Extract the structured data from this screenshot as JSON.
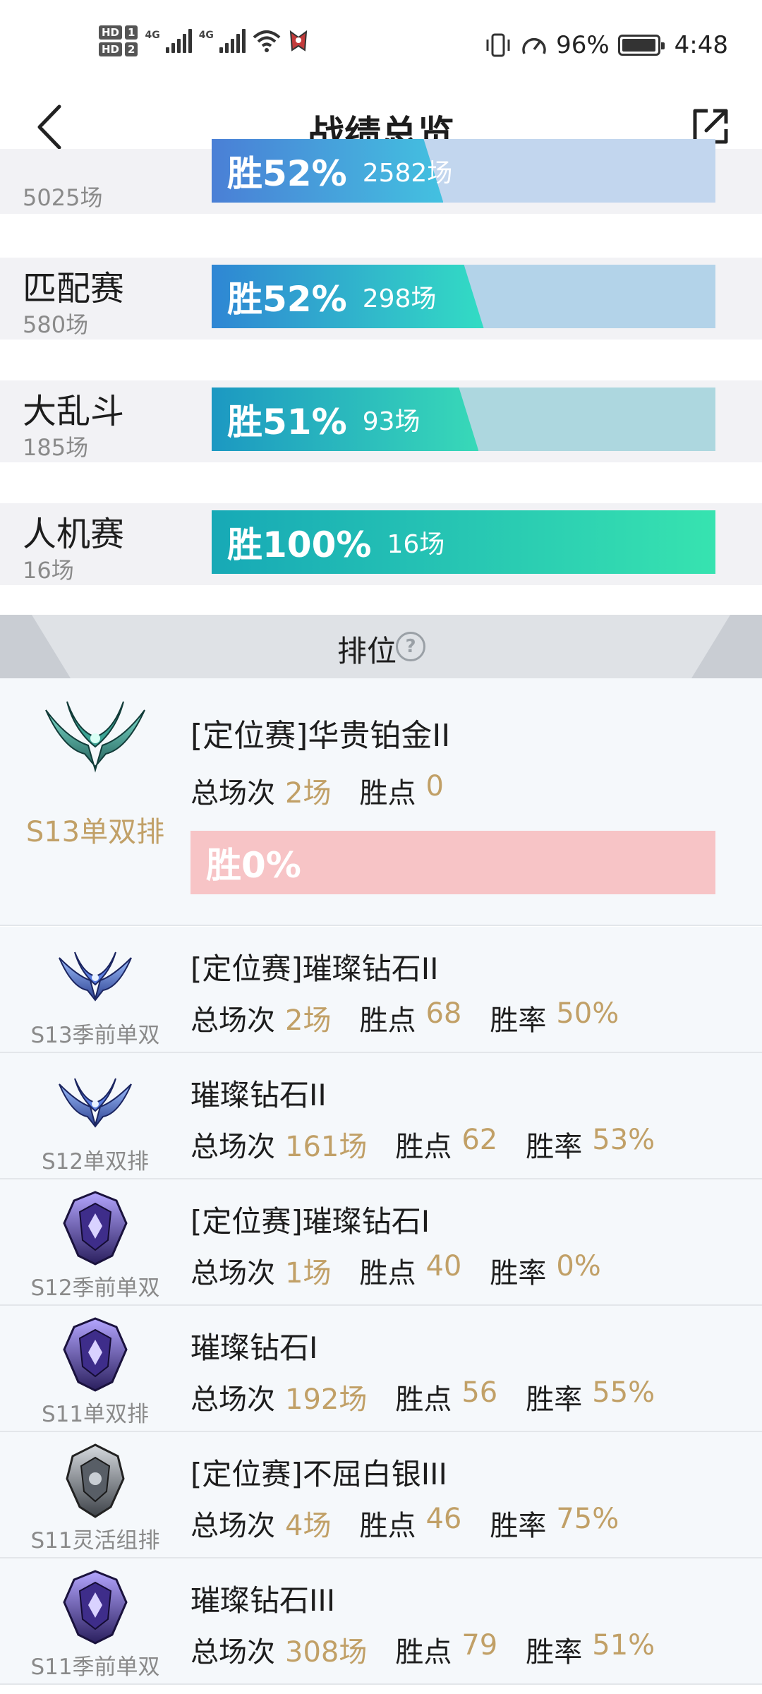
{
  "status_bar": {
    "left": {
      "hd1": "HD",
      "sim1": "1",
      "hd2": "HD",
      "sim2": "2",
      "net1": "4G",
      "net2": "4G"
    },
    "battery_percent": "96%",
    "time": "4:48"
  },
  "header": {
    "title": "战绩总览"
  },
  "modes": [
    {
      "name": "",
      "count": "5025场",
      "rate": "胜52%",
      "games": "2582场",
      "fill": 0.46,
      "colors": [
        "#4a7fd6",
        "#43c1e0"
      ],
      "track": "#c2d6ee"
    },
    {
      "name": "匹配赛",
      "count": "580场",
      "rate": "胜52%",
      "games": "298场",
      "fill": 0.54,
      "colors": [
        "#2f86d4",
        "#32dcc4"
      ],
      "track": "#b3d3e9"
    },
    {
      "name": "大乱斗",
      "count": "185场",
      "rate": "胜51%",
      "games": "93场",
      "fill": 0.53,
      "colors": [
        "#1c98c2",
        "#38d9b8"
      ],
      "track": "#add7df"
    },
    {
      "name": "人机赛",
      "count": "16场",
      "rate": "胜100%",
      "games": "16场",
      "fill": 1.0,
      "colors": [
        "#17a9b6",
        "#37e3b0"
      ],
      "track": "#b1e0de"
    }
  ],
  "ranked": {
    "title": "排位",
    "help": "?",
    "labels": {
      "total": "总场次",
      "points": "胜点",
      "winrate": "胜率"
    },
    "first": {
      "season": "S13单双排",
      "rank": "[定位赛]华贵铂金II",
      "total": "2场",
      "points": "0",
      "rate": "胜0%",
      "emblem": "platinum"
    },
    "rows": [
      {
        "season": "S13季前单双",
        "rank": "[定位赛]璀璨钻石II",
        "total": "2场",
        "points": "68",
        "winrate": "50%",
        "emblem": "diamond-wings"
      },
      {
        "season": "S12单双排",
        "rank": "璀璨钻石II",
        "total": "161场",
        "points": "62",
        "winrate": "53%",
        "emblem": "diamond-wings"
      },
      {
        "season": "S12季前单双",
        "rank": "[定位赛]璀璨钻石I",
        "total": "1场",
        "points": "40",
        "winrate": "0%",
        "emblem": "diamond-crest"
      },
      {
        "season": "S11单双排",
        "rank": "璀璨钻石I",
        "total": "192场",
        "points": "56",
        "winrate": "55%",
        "emblem": "diamond-crest"
      },
      {
        "season": "S11灵活组排",
        "rank": "[定位赛]不屈白银III",
        "total": "4场",
        "points": "46",
        "winrate": "75%",
        "emblem": "silver-crest"
      },
      {
        "season": "S11季前单双",
        "rank": "璀璨钻石III",
        "total": "308场",
        "points": "79",
        "winrate": "51%",
        "emblem": "diamond-crest"
      }
    ]
  },
  "colors": {
    "accent_gold": "#c1a067",
    "loss_bar": "#f7c4c6",
    "row_bg": "#f5f8fb"
  }
}
